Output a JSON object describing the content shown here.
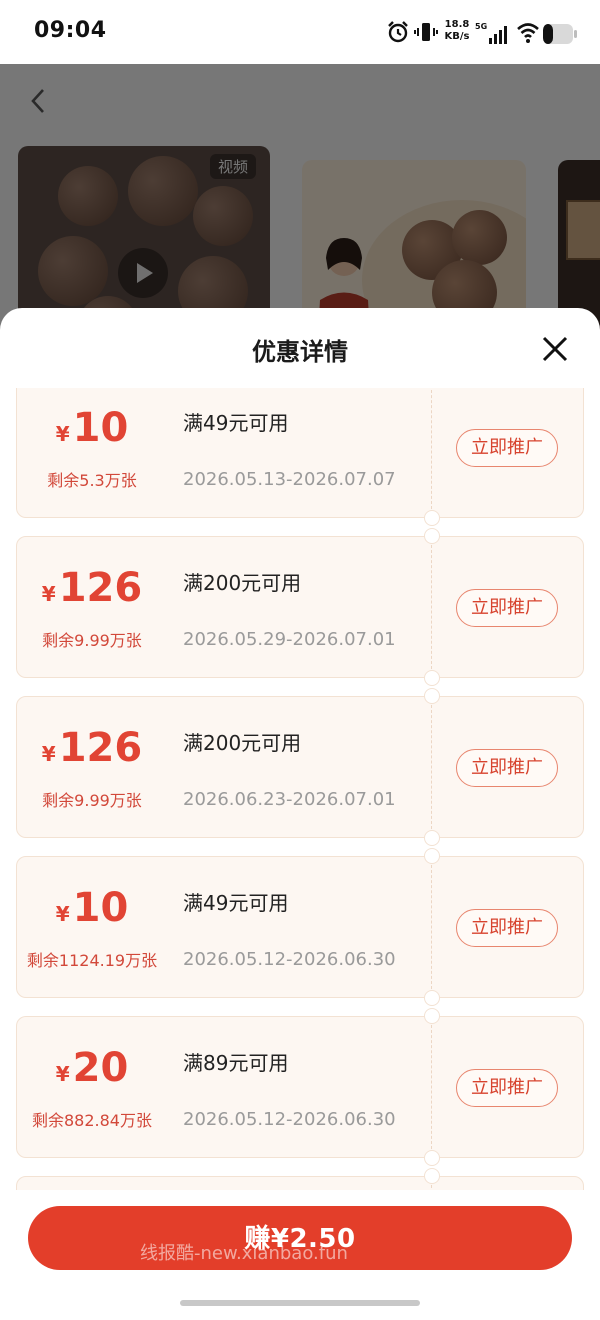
{
  "status_bar": {
    "time": "09:04",
    "net_speed_value": "18.8",
    "net_speed_unit": "KB/s",
    "network_type": "5G",
    "icons": [
      "alarm-icon",
      "vibrate-icon",
      "signal-icon",
      "wifi-icon",
      "battery-icon"
    ]
  },
  "background": {
    "video_badge": "视频",
    "icons": [
      "back-icon",
      "play-icon"
    ]
  },
  "sheet": {
    "title": "优惠详情",
    "close_icon": "close-icon"
  },
  "coupons": [
    {
      "currency": "¥",
      "amount": "10",
      "remaining": "剩余5.3万张",
      "condition": "满49元可用",
      "validity": "2026.05.13-2026.07.07",
      "action": "立即推广"
    },
    {
      "currency": "¥",
      "amount": "126",
      "remaining": "剩余9.99万张",
      "condition": "满200元可用",
      "validity": "2026.05.29-2026.07.01",
      "action": "立即推广"
    },
    {
      "currency": "¥",
      "amount": "126",
      "remaining": "剩余9.99万张",
      "condition": "满200元可用",
      "validity": "2026.06.23-2026.07.01",
      "action": "立即推广"
    },
    {
      "currency": "¥",
      "amount": "10",
      "remaining": "剩余1124.19万张",
      "condition": "满49元可用",
      "validity": "2026.05.12-2026.06.30",
      "action": "立即推广"
    },
    {
      "currency": "¥",
      "amount": "20",
      "remaining": "剩余882.84万张",
      "condition": "满89元可用",
      "validity": "2026.05.12-2026.06.30",
      "action": "立即推广"
    }
  ],
  "footer": {
    "earn_label": "赚¥2.50",
    "watermark": "线报酷-new.xianbao.fun"
  },
  "colors": {
    "accent_red": "#e33e2a",
    "coupon_bg": "#fdf7f2",
    "coupon_border": "#f3e2d3"
  }
}
